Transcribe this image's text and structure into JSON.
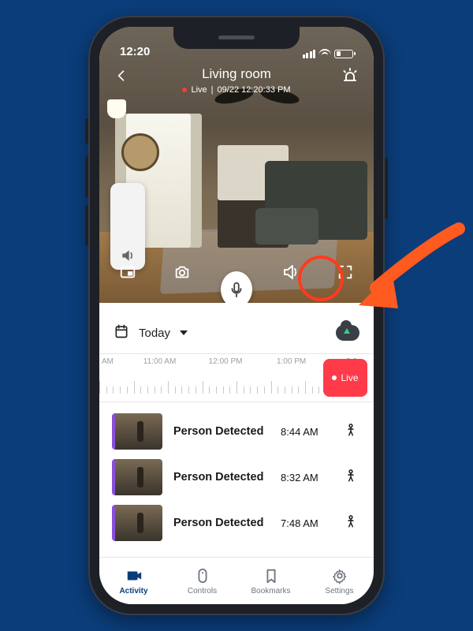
{
  "statusbar": {
    "time": "12:20"
  },
  "camera": {
    "title": "Living room",
    "live_prefix": "Live",
    "timestamp": "09/22 12:20:33 PM"
  },
  "daterow": {
    "label": "Today"
  },
  "timeline": {
    "labels": [
      "AM",
      "11:00 AM",
      "12:00 PM",
      "1:00 PM",
      "2:0"
    ],
    "live_label": "Live"
  },
  "events": [
    {
      "title": "Person Detected",
      "time": "8:44 AM"
    },
    {
      "title": "Person Detected",
      "time": "8:32 AM"
    },
    {
      "title": "Person Detected",
      "time": "7:48 AM"
    }
  ],
  "tabs": {
    "activity": "Activity",
    "controls": "Controls",
    "bookmarks": "Bookmarks",
    "settings": "Settings"
  },
  "annotation": {
    "highlight": "speaker-mute-button",
    "color": "#ff3b1f"
  }
}
